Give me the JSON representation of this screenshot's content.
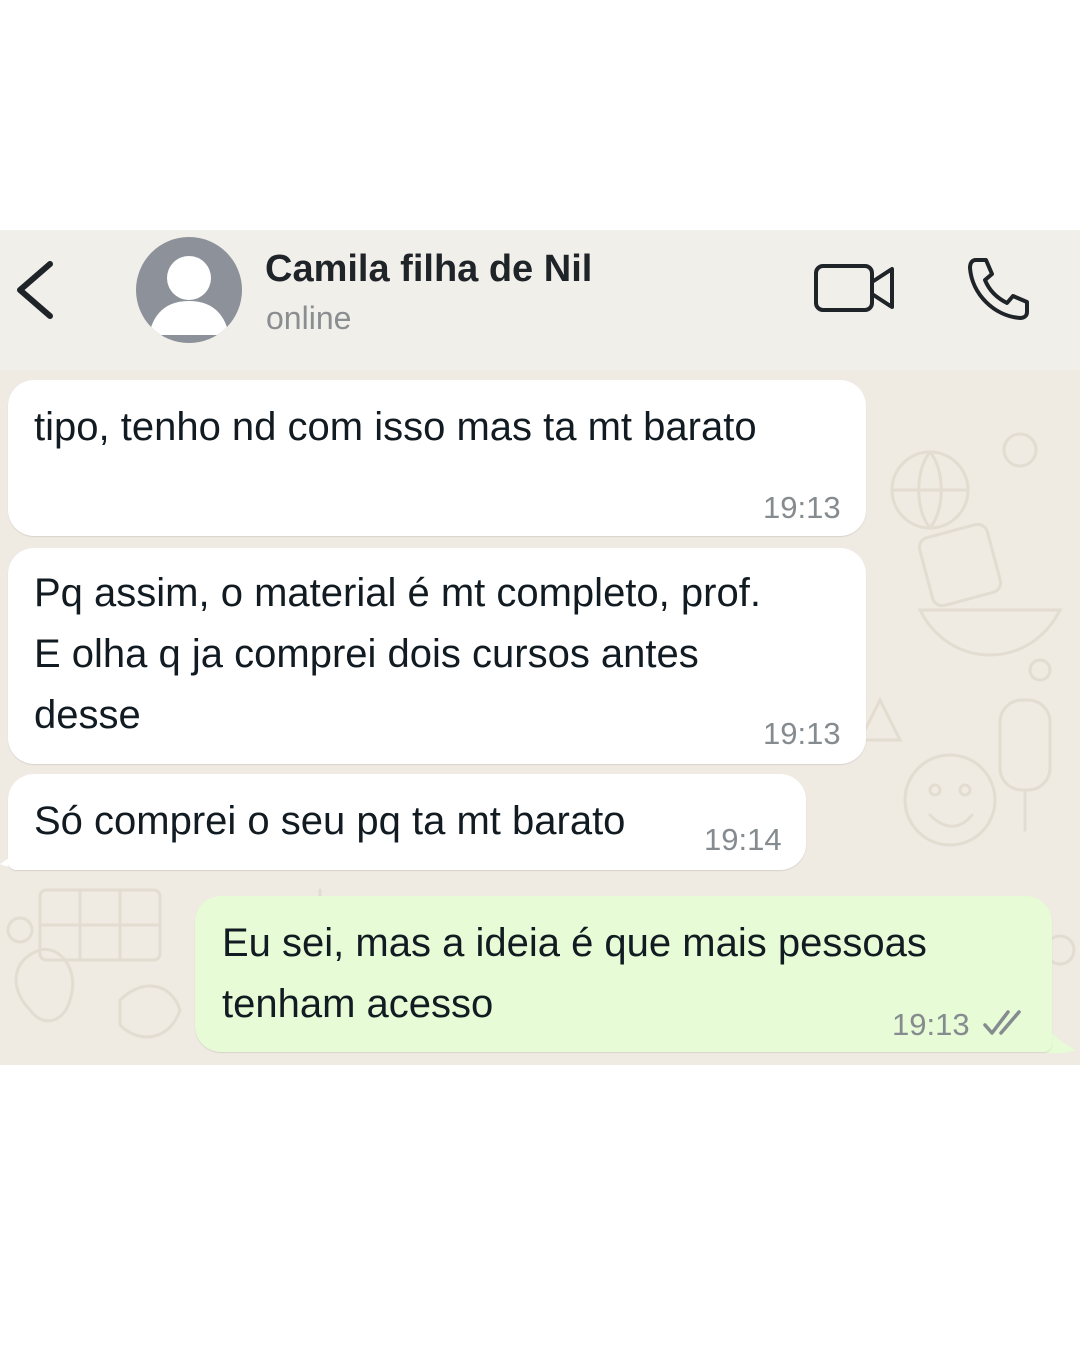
{
  "header": {
    "back_icon": "chevron-left-icon",
    "avatar_icon": "default-avatar-icon",
    "contact_name": "Camila filha de Nil",
    "status": "online",
    "video_call_icon": "video-camera-icon",
    "voice_call_icon": "phone-icon"
  },
  "messages": [
    {
      "direction": "incoming",
      "lines": [
        "tipo, tenho nd com isso mas ta mt barato"
      ],
      "time": "19:13"
    },
    {
      "direction": "incoming",
      "lines": [
        "Pq assim, o material é mt completo, prof.",
        "E olha q ja comprei dois cursos antes",
        "desse"
      ],
      "time": "19:13"
    },
    {
      "direction": "incoming",
      "lines": [
        "Só comprei o seu pq ta mt barato"
      ],
      "time": "19:14"
    },
    {
      "direction": "outgoing",
      "lines": [
        "Eu sei, mas a ideia é que mais pessoas",
        "tenham acesso"
      ],
      "time": "19:13",
      "status_icon": "double-check-icon"
    }
  ],
  "colors": {
    "header_bg": "#f1efea",
    "chat_bg": "#efeae2",
    "incoming_bubble": "#ffffff",
    "outgoing_bubble": "#e6fbd6",
    "text": "#111b21",
    "time": "#858b8f"
  }
}
